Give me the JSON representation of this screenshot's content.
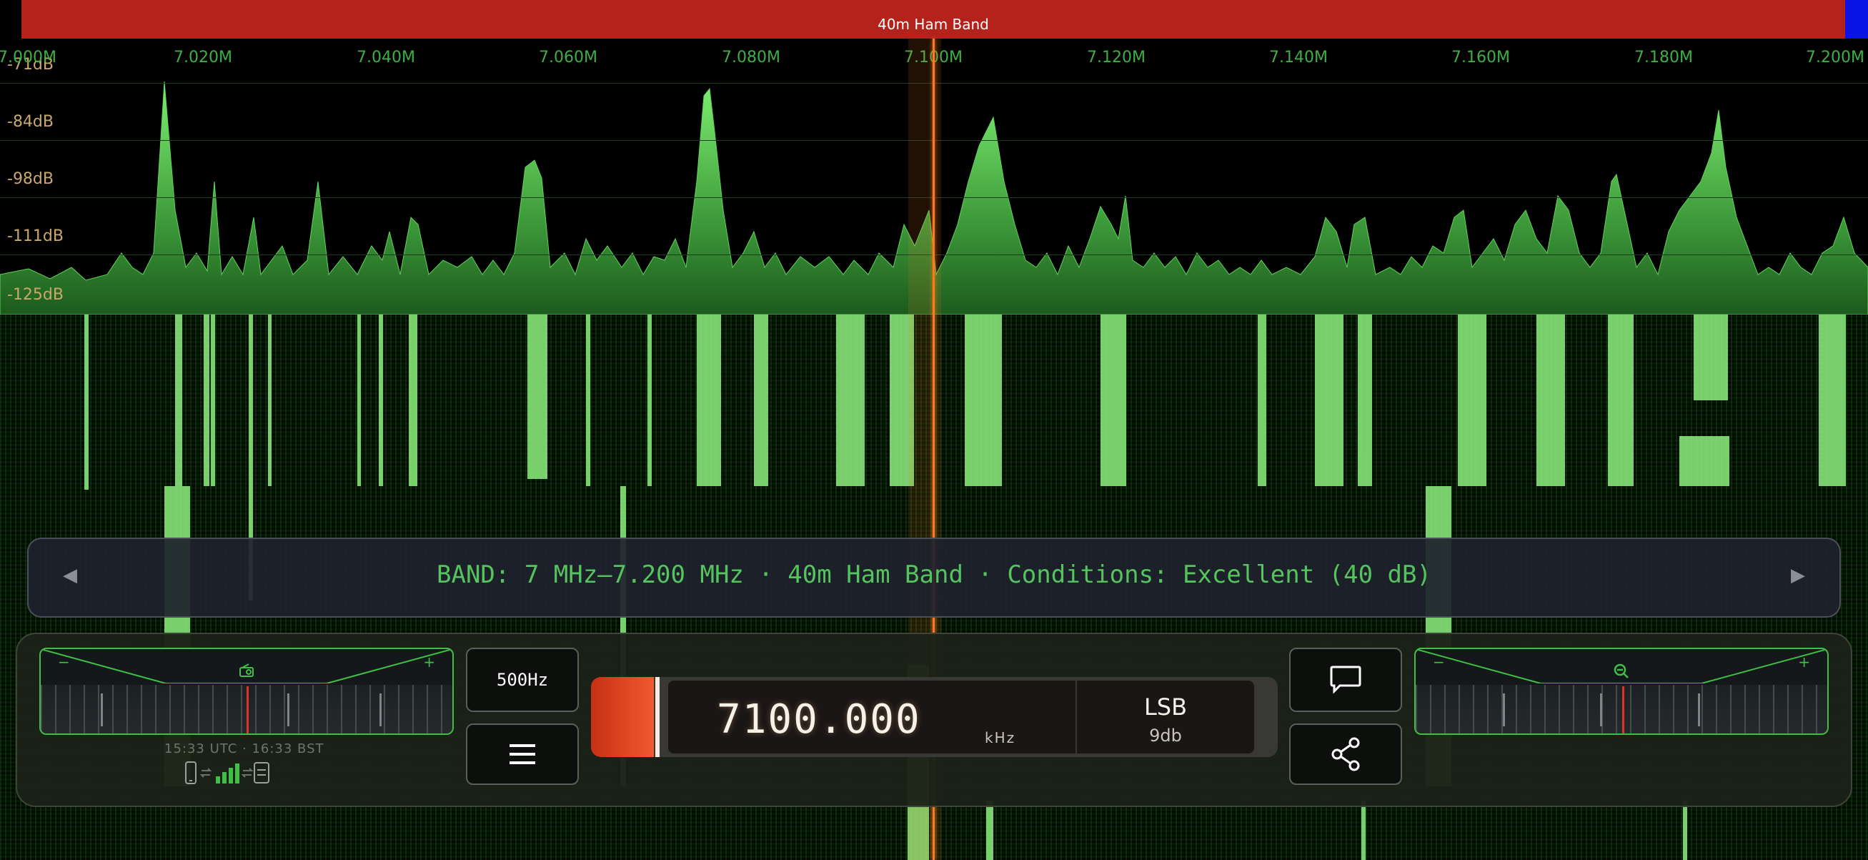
{
  "band_bar": {
    "label": "40m Ham Band",
    "color": "#b3221b"
  },
  "frequency_scale": [
    "7.000M",
    "7.020M",
    "7.040M",
    "7.060M",
    "7.080M",
    "7.100M",
    "7.120M",
    "7.140M",
    "7.160M",
    "7.180M",
    "7.200M"
  ],
  "db_scale": [
    "-71dB",
    "-84dB",
    "-98dB",
    "-111dB",
    "-125dB"
  ],
  "banner": {
    "text": "BAND: 7 MHz–7.200 MHz · 40m Ham Band · Conditions: Excellent (40 dB)",
    "prev_arrow": "◀",
    "next_arrow": "▶"
  },
  "left_dial": {
    "minus": "−",
    "plus": "+",
    "icon": "radio-icon"
  },
  "right_dial": {
    "minus": "−",
    "plus": "+",
    "icon": "zoom-out-icon"
  },
  "clock": "15:33 UTC · 16:33 BST",
  "status_icons": [
    "phone-icon",
    "swap-icon",
    "signal-bars-icon",
    "swap-icon",
    "receiver-icon"
  ],
  "bandwidth_button": "500Hz",
  "menu_button": {
    "icon": "hamburger-icon"
  },
  "frequency": {
    "value": "7100.000",
    "unit": "kHz"
  },
  "mode": {
    "value": "LSB",
    "sub": "9db"
  },
  "chat_button": {
    "icon": "chat-bubble-icon"
  },
  "share_button": {
    "icon": "share-icon"
  },
  "colors": {
    "accent_green": "#3fbf46",
    "tuning": "#ff7a1a",
    "band_red": "#b3221b"
  }
}
